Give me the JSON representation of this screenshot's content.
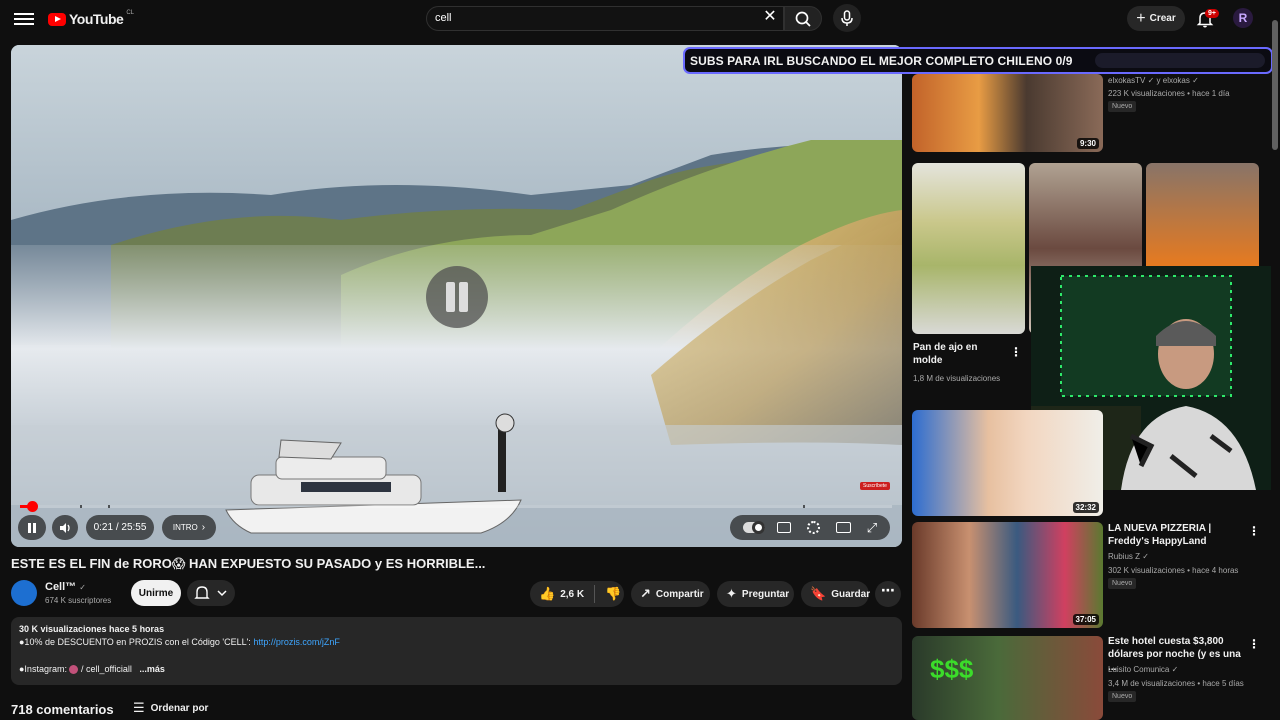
{
  "header": {
    "logo_text": "YouTube",
    "country": "CL",
    "search_value": "cell",
    "create_label": "Crear",
    "notif_count": "9+"
  },
  "player": {
    "time": "0:21 / 25:55",
    "chapter": "INTRO",
    "subscribe_mark": "Suscríbete",
    "progress_fraction": 0.0135
  },
  "stream_overlay": {
    "banner": "SUBS PARA IRL BUSCANDO EL MEJOR COMPLETO CHILENO 0/9"
  },
  "video": {
    "title": "ESTE ES EL FIN de RORO😱 HAN EXPUESTO SU PASADO y ES HORRIBLE...",
    "channel": "Cell™",
    "subscribers": "674 K suscriptores",
    "join_label": "Unirme",
    "likes": "2,6 K",
    "share_label": "Compartir",
    "ask_label": "Preguntar",
    "save_label": "Guardar"
  },
  "description": {
    "stats": "30 K visualizaciones  hace 5 horas",
    "promo": "●10% de DESCUENTO en PROZIS con el Código 'CELL': ",
    "promo_link": "http://prozis.com/jZnF",
    "instagram_label": "●Instagram:",
    "instagram_handle": "/ cell_officiall",
    "more": "...más"
  },
  "comments": {
    "count": "718 comentarios",
    "sort_label": "Ordenar por"
  },
  "sidebar": {
    "top": {
      "channel": "elxokasTV",
      "channel_extra": "y elxokas",
      "meta": "223 K visualizaciones • hace 1 día",
      "badge": "Nuevo",
      "duration": "9:30"
    },
    "shorts": [
      {
        "title": "Pan de ajo en molde",
        "views": "1,8 M de visualizaciones"
      }
    ],
    "rec1": {
      "duration": "32:32"
    },
    "rec2": {
      "title": "LA NUEVA PIZZERIA | Freddy's HappyLand",
      "channel": "Rubius Z",
      "meta": "302 K visualizaciones • hace 4 horas",
      "badge": "Nuevo",
      "duration": "37:05"
    },
    "rec3": {
      "title": "Este hotel cuesta $3,800 dólares por noche (y es una ...",
      "channel": "Luisito Comunica",
      "meta": "3,4 M de visualizaciones • hace 5 días",
      "badge": "Nuevo",
      "thumb_text": "$$$"
    }
  }
}
